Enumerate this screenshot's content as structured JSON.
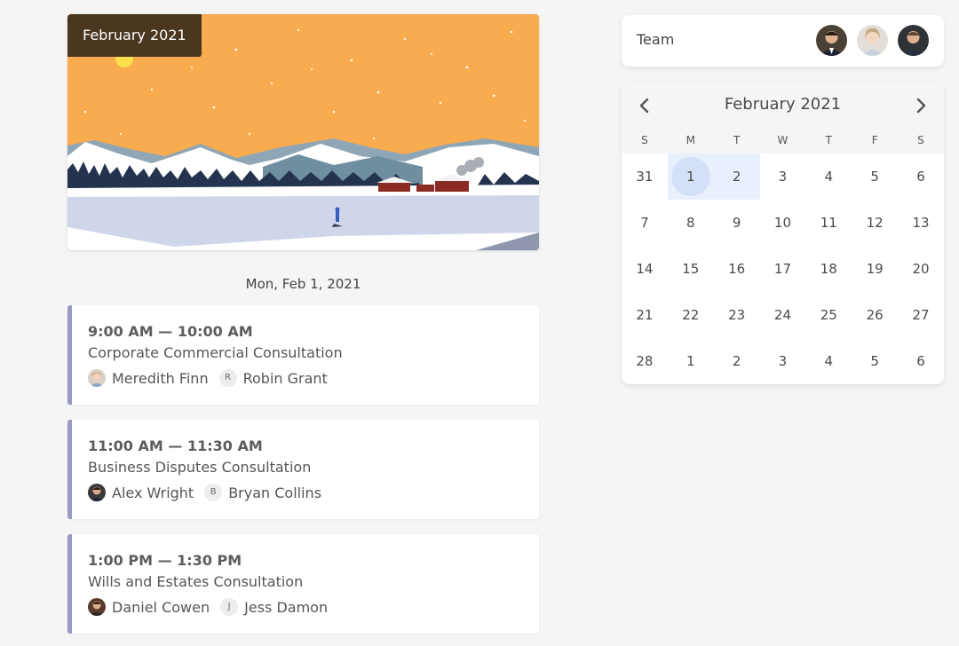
{
  "hero": {
    "badge": "February 2021"
  },
  "agenda": {
    "date_heading": "Mon, Feb 1, 2021",
    "events": [
      {
        "time": "9:00 AM — 10:00 AM",
        "title": "Corporate Commercial Consultation",
        "people": [
          {
            "type": "photo",
            "icon": "avatar-female-icon",
            "name": "Meredith Finn"
          },
          {
            "type": "initial",
            "initial": "R",
            "name": "Robin Grant"
          }
        ]
      },
      {
        "time": "11:00 AM — 11:30 AM",
        "title": "Business Disputes Consultation",
        "people": [
          {
            "type": "photo",
            "icon": "avatar-male-icon",
            "name": "Alex Wright"
          },
          {
            "type": "initial",
            "initial": "B",
            "name": "Bryan Collins"
          }
        ]
      },
      {
        "time": "1:00 PM — 1:30 PM",
        "title": "Wills and Estates Consultation",
        "people": [
          {
            "type": "photo",
            "icon": "avatar-male-icon",
            "name": "Daniel Cowen"
          },
          {
            "type": "initial",
            "initial": "J",
            "name": "Jess Damon"
          }
        ]
      }
    ]
  },
  "team": {
    "label": "Team",
    "members": [
      {
        "icon": "avatar-male-icon"
      },
      {
        "icon": "avatar-female-icon"
      },
      {
        "icon": "avatar-male-icon"
      }
    ]
  },
  "calendar": {
    "month_label": "February 2021",
    "prev_icon": "chevron-left-icon",
    "next_icon": "chevron-right-icon",
    "weekdays": [
      "S",
      "M",
      "T",
      "W",
      "T",
      "F",
      "S"
    ],
    "weeks": [
      [
        "31",
        "1",
        "2",
        "3",
        "4",
        "5",
        "6"
      ],
      [
        "7",
        "8",
        "9",
        "10",
        "11",
        "12",
        "13"
      ],
      [
        "14",
        "15",
        "16",
        "17",
        "18",
        "19",
        "20"
      ],
      [
        "21",
        "22",
        "23",
        "24",
        "25",
        "26",
        "27"
      ],
      [
        "28",
        "1",
        "2",
        "3",
        "4",
        "5",
        "6"
      ]
    ],
    "selected_date": "1",
    "highlight_color": "#e9f0fd",
    "selected_color": "#d3e0f8"
  },
  "colors": {
    "event_accent": "#9a9bc2",
    "badge_background": "#4b3620",
    "sky": "#f8ab4f"
  }
}
